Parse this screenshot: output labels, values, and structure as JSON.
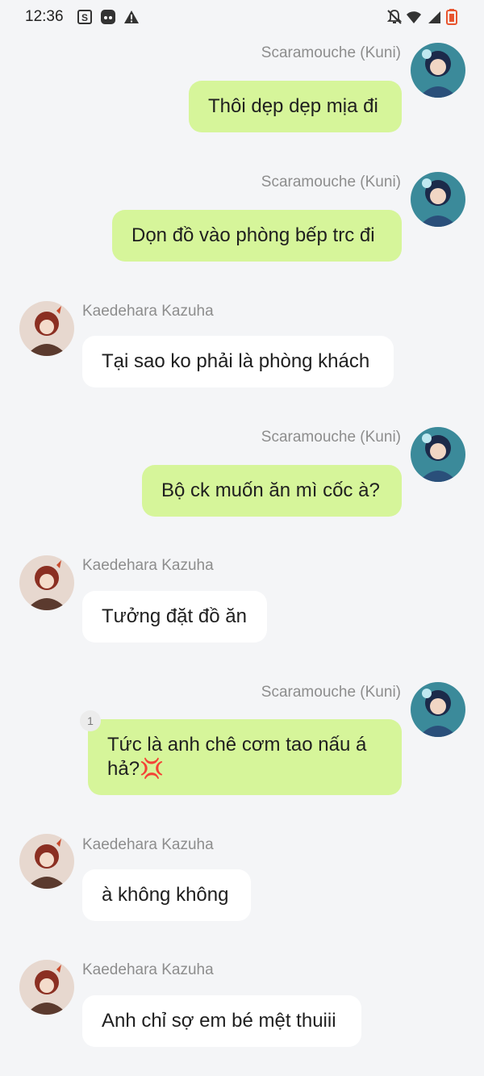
{
  "status_bar": {
    "time": "12:36",
    "left_icons": [
      "screenshot-icon",
      "discord-icon",
      "warning-icon"
    ],
    "right_icons": [
      "notifications-off-icon",
      "wifi-icon",
      "signal-icon",
      "battery-icon"
    ],
    "battery_color": "#e8552f"
  },
  "colors": {
    "background": "#f4f5f7",
    "outgoing_bubble": "#d6f59a",
    "incoming_bubble": "#ffffff",
    "sender_name": "#8d8d8d"
  },
  "messages": [
    {
      "sender": "Scaramouche (Kuni)",
      "direction": "outgoing",
      "text": "Thôi dẹp dẹp mịa đi"
    },
    {
      "sender": "Scaramouche (Kuni)",
      "direction": "outgoing",
      "text": "Dọn đồ vào phòng bếp trc đi"
    },
    {
      "sender": "Kaedehara Kazuha",
      "direction": "incoming",
      "text": "Tại sao ko phải là phòng khách"
    },
    {
      "sender": "Scaramouche (Kuni)",
      "direction": "outgoing",
      "text": "Bộ ck muốn ăn mì cốc à?"
    },
    {
      "sender": "Kaedehara Kazuha",
      "direction": "incoming",
      "text": "Tưởng đặt đồ ăn"
    },
    {
      "sender": "Scaramouche (Kuni)",
      "direction": "outgoing",
      "text_line1": "Tức là anh chê cơm tao nấu á",
      "text_line2": "hả?",
      "emoji": "💢",
      "reaction_count": "1"
    },
    {
      "sender": "Kaedehara Kazuha",
      "direction": "incoming",
      "text": "à không không"
    },
    {
      "sender": "Kaedehara Kazuha",
      "direction": "incoming",
      "text": "Anh chỉ sợ em bé mệt thuiii"
    }
  ]
}
